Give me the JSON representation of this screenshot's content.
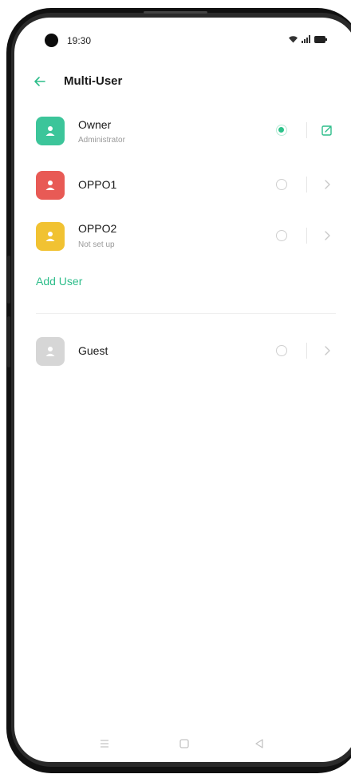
{
  "status_bar": {
    "time": "19:30"
  },
  "header": {
    "title": "Multi-User"
  },
  "users": [
    {
      "name": "Owner",
      "subtitle": "Administrator",
      "avatar_color": "#3cc59a",
      "selected": true,
      "action_icon": "edit-icon"
    },
    {
      "name": "OPPO1",
      "subtitle": "",
      "avatar_color": "#e85a55",
      "selected": false,
      "action_icon": "chevron-right-icon"
    },
    {
      "name": "OPPO2",
      "subtitle": "Not set up",
      "avatar_color": "#f1c232",
      "selected": false,
      "action_icon": "chevron-right-icon"
    }
  ],
  "add_user_label": "Add User",
  "guest": {
    "name": "Guest",
    "avatar_color": "#d6d6d6",
    "selected": false,
    "action_icon": "chevron-right-icon"
  },
  "colors": {
    "accent": "#2dbd8a"
  },
  "nav_icons": [
    "menu-icon",
    "home-icon",
    "back-triangle-icon"
  ]
}
